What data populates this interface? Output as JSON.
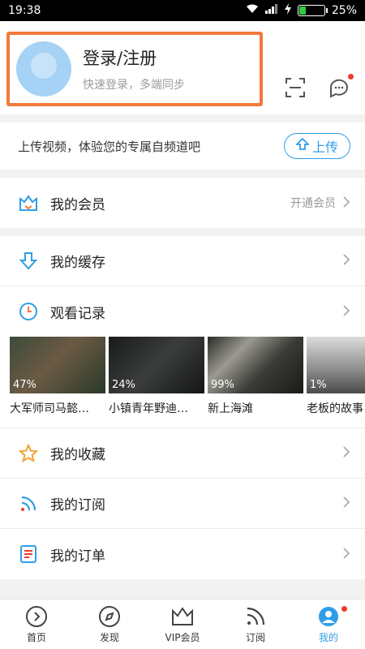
{
  "status_bar": {
    "time": "19:38",
    "battery": "25%"
  },
  "profile": {
    "title": "登录/注册",
    "subtitle": "快速登录，多端同步"
  },
  "upload": {
    "text": "上传视频，体验您的专属自频道吧",
    "button": "上传"
  },
  "membership": {
    "label": "我的会员",
    "action": "开通会员"
  },
  "cache": {
    "label": "我的缓存"
  },
  "history": {
    "label": "观看记录",
    "items": [
      {
        "title": "大军师司马懿…",
        "progress": "47%"
      },
      {
        "title": "小镇青年野迪…",
        "progress": "24%"
      },
      {
        "title": "新上海滩",
        "progress": "99%"
      },
      {
        "title": "老板的故事",
        "progress": "1%"
      }
    ]
  },
  "menu": {
    "favorites": "我的收藏",
    "subscriptions": "我的订阅",
    "orders": "我的订单"
  },
  "tabs": [
    {
      "label": "首页"
    },
    {
      "label": "发现"
    },
    {
      "label": "VIP会员"
    },
    {
      "label": "订阅"
    },
    {
      "label": "我的"
    }
  ],
  "colors": {
    "accent": "#2f9ee8",
    "highlight_border": "#f07a3b",
    "badge": "#f03b2f"
  }
}
